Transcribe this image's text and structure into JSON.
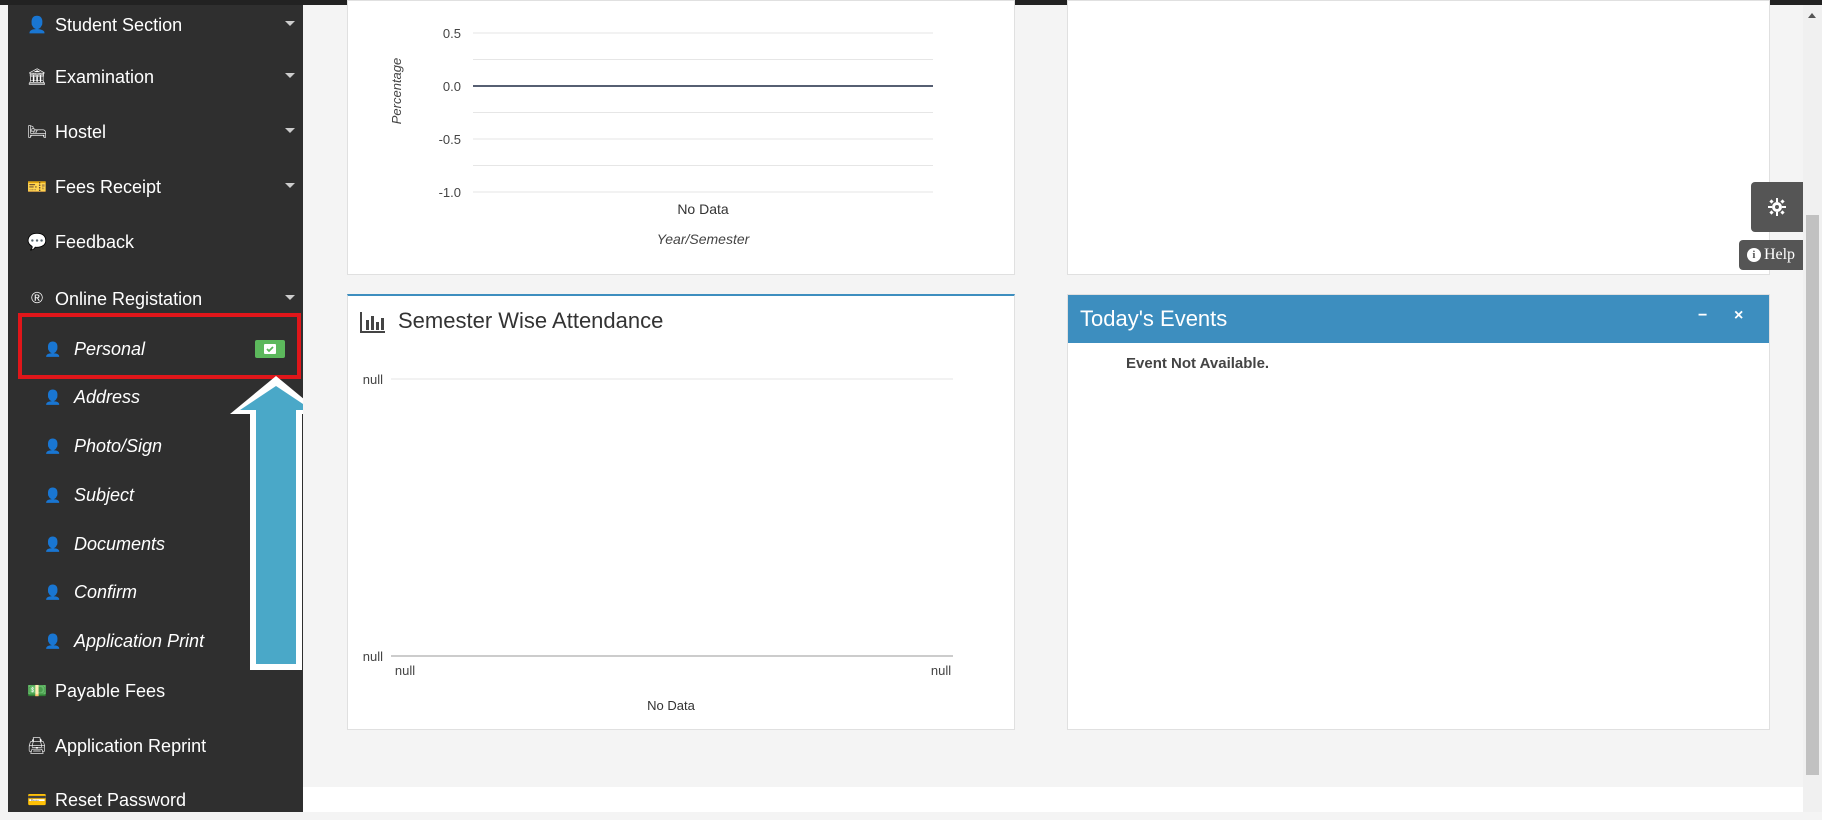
{
  "sidebar": {
    "items": [
      {
        "label": "Student Section",
        "icon": "user-icon"
      },
      {
        "label": "Examination",
        "icon": "bank-icon"
      },
      {
        "label": "Hostel",
        "icon": "bed-icon"
      },
      {
        "label": "Fees Receipt",
        "icon": "ticket-icon"
      },
      {
        "label": "Feedback",
        "icon": "comments-icon"
      },
      {
        "label": "Online Registation",
        "icon": "registered-icon"
      }
    ],
    "sub_items": [
      {
        "label": "Personal"
      },
      {
        "label": "Address"
      },
      {
        "label": "Photo/Sign"
      },
      {
        "label": "Subject"
      },
      {
        "label": "Documents"
      },
      {
        "label": "Confirm"
      },
      {
        "label": "Application Print"
      }
    ],
    "bottom_items": [
      {
        "label": "Payable Fees",
        "icon": "money-icon"
      },
      {
        "label": "Application Reprint",
        "icon": "print-icon"
      },
      {
        "label": "Reset Password",
        "icon": "card-icon"
      }
    ]
  },
  "result_chart": {
    "chart_data": {
      "type": "line",
      "ylabel": "Percentage",
      "xlabel": "Year/Semester",
      "ylim": [
        -1.0,
        0.5
      ],
      "yticks": [
        "0.5",
        "0.0",
        "-0.5",
        "-1.0"
      ],
      "categories": [
        "No Data"
      ],
      "values": [
        0.0
      ]
    }
  },
  "attendance": {
    "title": "Semester Wise Attendance",
    "chart_data": {
      "type": "line",
      "yticks": [
        "null",
        "null"
      ],
      "xticks": [
        "null",
        "null"
      ],
      "xlabel": "No Data",
      "values": []
    }
  },
  "events": {
    "title": "Today's Events",
    "message": "Event Not Available.",
    "minimize": "−",
    "close": "×"
  },
  "help": {
    "label": "Help"
  },
  "colors": {
    "sidebar": "#2f2f2f",
    "events_header": "#3d8ebf",
    "badge": "#5cb85c",
    "highlight": "#e0161a",
    "arrow": "#4aa8c8"
  }
}
